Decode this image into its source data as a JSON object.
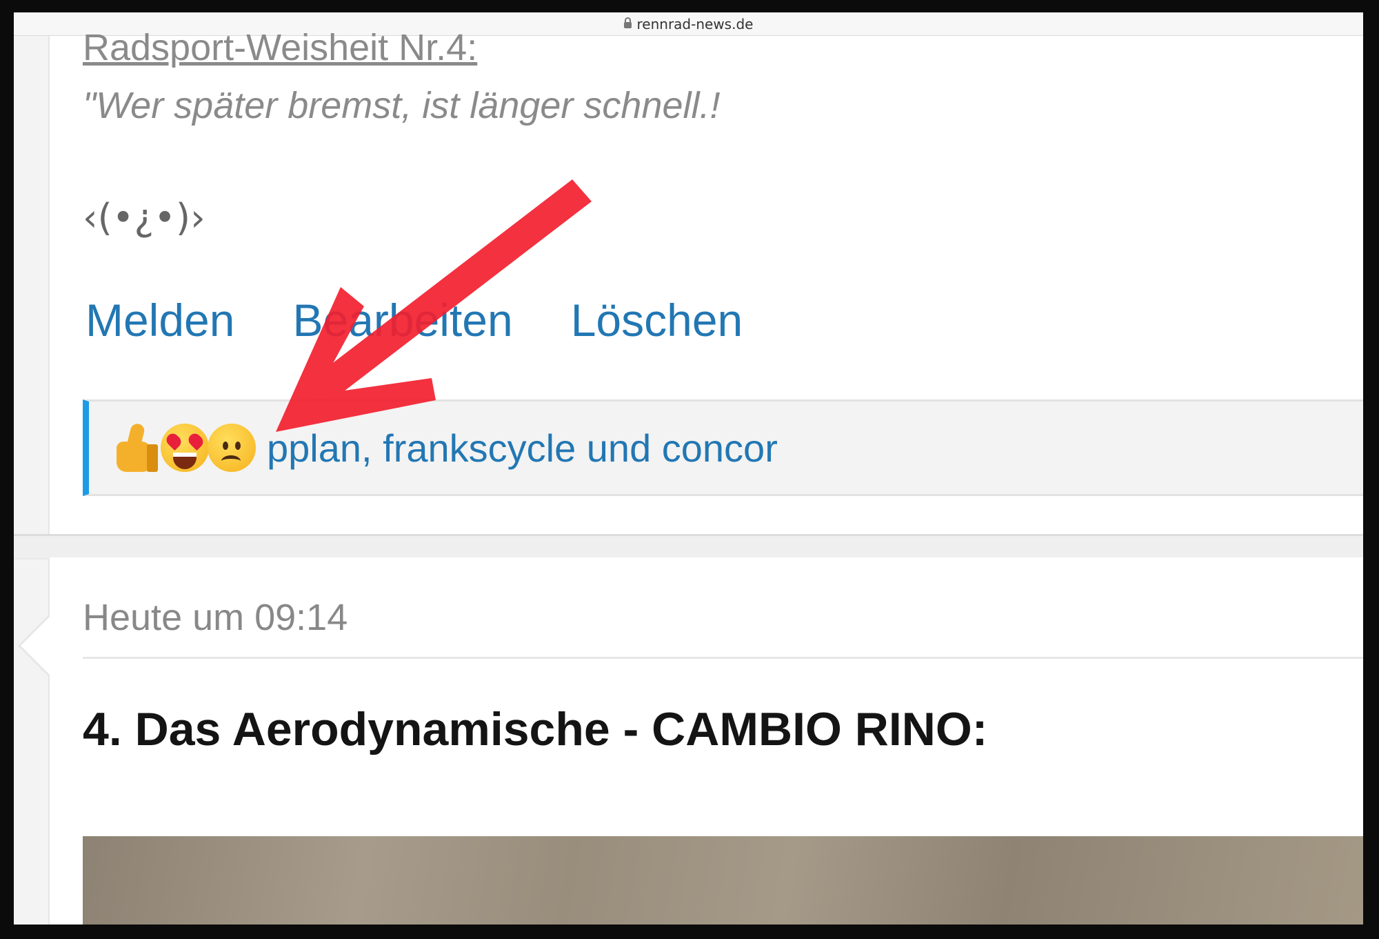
{
  "browser": {
    "url": "rennrad-news.de"
  },
  "signature": {
    "title": "Radsport-Weisheit Nr.4:",
    "quote": "\"Wer später bremst, ist länger schnell.!",
    "ascii_face": "‹(•¿•)›"
  },
  "post_actions": {
    "report_label": "Melden",
    "edit_label": "Bearbeiten",
    "delete_label": "Löschen"
  },
  "reactions": {
    "icons": [
      "thumbs-up-icon",
      "heart-eyes-icon",
      "sad-face-icon"
    ],
    "users_text": "pplan, frankscycle und concor"
  },
  "next_post": {
    "timestamp": "Heute um 09:14",
    "heading": "4. Das Aerodynamische - CAMBIO RINO:"
  },
  "colors": {
    "link": "#2277b3",
    "accent_bar": "#1d9be6",
    "annotation_arrow": "#f2202f"
  }
}
